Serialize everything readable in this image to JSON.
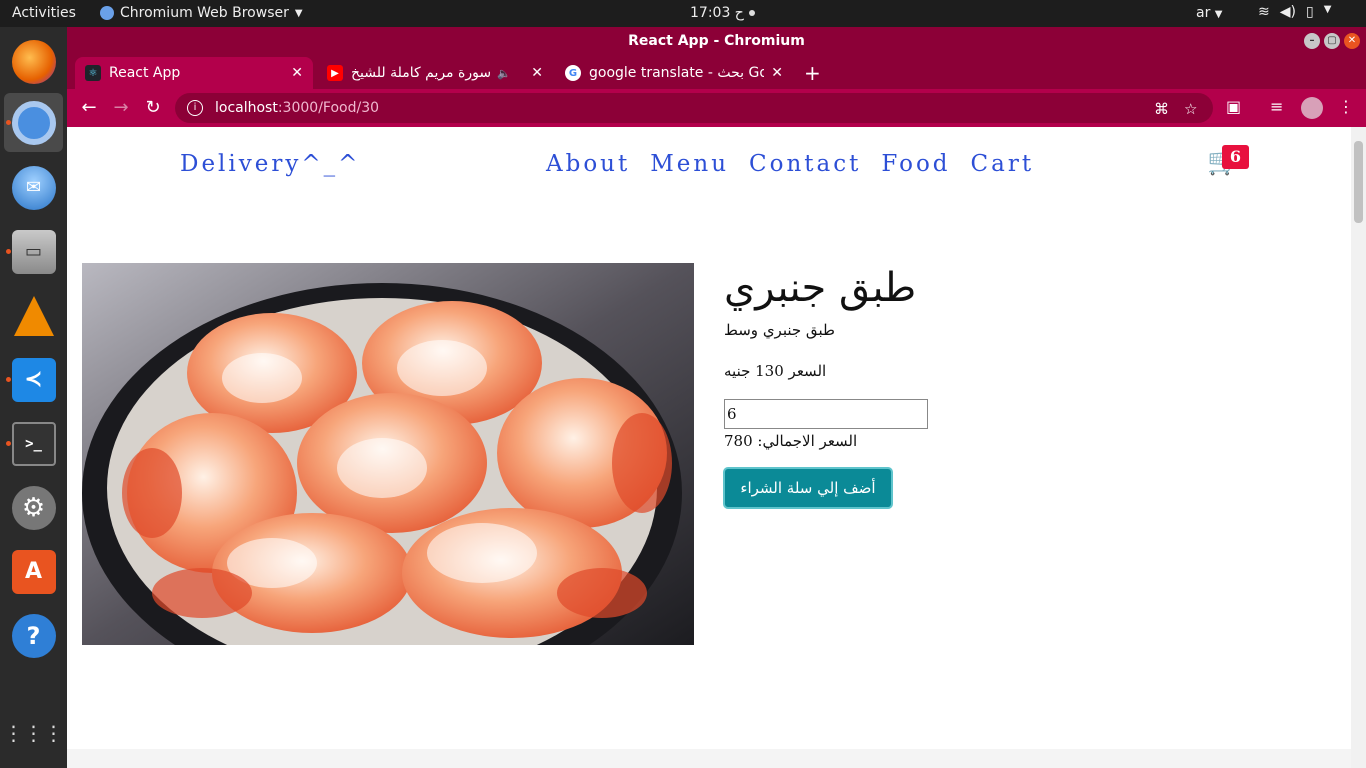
{
  "system": {
    "activities": "Activities",
    "app_menu": "Chromium Web Browser",
    "clock": "ح 17:03",
    "language": "ar"
  },
  "dock": {
    "items": [
      {
        "name": "firefox-icon",
        "color": "#e66000"
      },
      {
        "name": "chromium-icon",
        "color": "#4a8fe0"
      },
      {
        "name": "thunderbird-icon",
        "color": "#2a75c8"
      },
      {
        "name": "files-icon",
        "color": "#8a8a8a"
      },
      {
        "name": "vlc-icon",
        "color": "#f08a00"
      },
      {
        "name": "vscode-icon",
        "color": "#1e88e5"
      },
      {
        "name": "terminal-icon",
        "color": "#333333"
      },
      {
        "name": "settings-icon",
        "color": "#777777"
      },
      {
        "name": "software-icon",
        "color": "#e95420"
      },
      {
        "name": "help-icon",
        "color": "#2f7fd6"
      }
    ]
  },
  "window": {
    "title": "React App - Chromium"
  },
  "tabs": [
    {
      "label": "React App",
      "active": true
    },
    {
      "label": "سورة مريم كاملة للشيخ",
      "active": false
    },
    {
      "label": "google translate - بحث Go",
      "active": false
    }
  ],
  "address": {
    "host": "localhost",
    "path": ":3000/Food/30"
  },
  "nav": {
    "brand": "Delivery^_^",
    "links": [
      "About",
      "Menu",
      "Contact",
      "Food",
      "Cart"
    ],
    "cart_count": "6"
  },
  "food": {
    "title": "طبق جنبري",
    "description": "طبق جنبري وسط",
    "price": "السعر 130 جنيه",
    "quantity": "6",
    "total": "السعر الاجمالي: 780",
    "add_button": "أضف إلي سلة الشراء"
  },
  "colors": {
    "accent": "#b3004b",
    "link": "#2d4fd6",
    "badge": "#e8113e",
    "button": "#0b8a97"
  }
}
